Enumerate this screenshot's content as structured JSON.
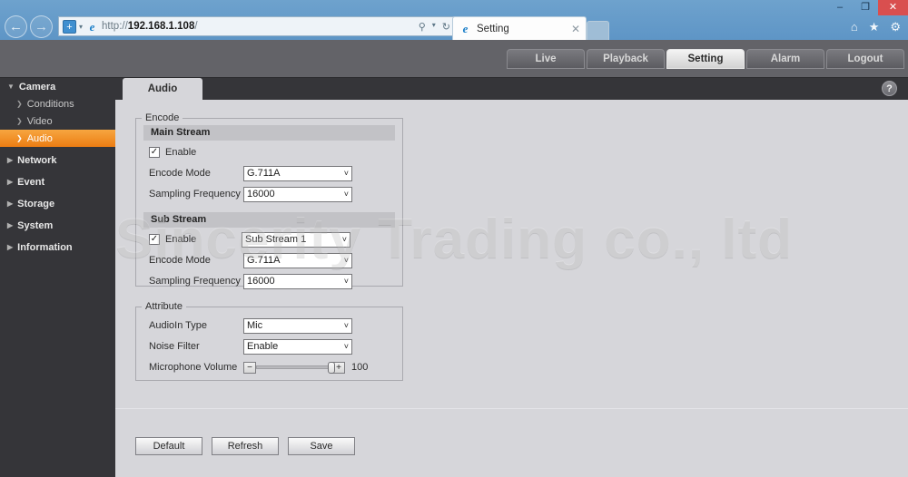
{
  "browser": {
    "window_controls": {
      "minimize": "–",
      "maximize": "❐",
      "close": "✕"
    },
    "back_icon": "←",
    "forward_icon": "→",
    "compat_icon": "+",
    "ie_logo": "e",
    "url_prefix": "http://",
    "url_host": "192.168.1.108",
    "url_suffix": "/",
    "search_icon": "⚲",
    "refresh_icon": "↻",
    "tab": {
      "title": "Setting",
      "close_icon": "✕"
    },
    "tools": {
      "home_icon": "⌂",
      "favorites_icon": "★",
      "settings_icon": "⚙"
    }
  },
  "app": {
    "brand": "",
    "tabs": [
      {
        "label": "Live",
        "active": false
      },
      {
        "label": "Playback",
        "active": false
      },
      {
        "label": "Setting",
        "active": true
      },
      {
        "label": "Alarm",
        "active": false
      },
      {
        "label": "Logout",
        "active": false
      }
    ]
  },
  "sidebar": {
    "items": [
      {
        "label": "Camera",
        "level": "group",
        "expanded": true,
        "icon": "▼"
      },
      {
        "label": "Conditions",
        "level": "child",
        "icon": "❯"
      },
      {
        "label": "Video",
        "level": "child",
        "icon": "❯"
      },
      {
        "label": "Audio",
        "level": "child",
        "icon": "❯",
        "active": true
      },
      {
        "label": "Network",
        "level": "group",
        "icon": "▶"
      },
      {
        "label": "Event",
        "level": "group",
        "icon": "▶"
      },
      {
        "label": "Storage",
        "level": "group",
        "icon": "▶"
      },
      {
        "label": "System",
        "level": "group",
        "icon": "▶"
      },
      {
        "label": "Information",
        "level": "group",
        "icon": "▶"
      }
    ]
  },
  "content": {
    "page_tab": "Audio",
    "help_icon": "?",
    "encode": {
      "legend": "Encode",
      "main_stream": {
        "header": "Main Stream",
        "enable_label": "Enable",
        "enable_checked": true,
        "check_glyph": "✓",
        "encode_mode_label": "Encode Mode",
        "encode_mode_value": "G.711A",
        "sampling_label": "Sampling Frequency",
        "sampling_value": "16000"
      },
      "sub_stream": {
        "header": "Sub Stream",
        "enable_label": "Enable",
        "enable_checked": true,
        "check_glyph": "✓",
        "stream_select_value": "Sub Stream 1",
        "encode_mode_label": "Encode Mode",
        "encode_mode_value": "G.711A",
        "sampling_label": "Sampling Frequency",
        "sampling_value": "16000"
      }
    },
    "attribute": {
      "legend": "Attribute",
      "audioin_label": "AudioIn Type",
      "audioin_value": "Mic",
      "noise_label": "Noise Filter",
      "noise_value": "Enable",
      "volume_label": "Microphone Volume",
      "volume_minus": "−",
      "volume_plus": "+",
      "volume_value": "100"
    },
    "buttons": [
      {
        "label": "Default"
      },
      {
        "label": "Refresh"
      },
      {
        "label": "Save"
      }
    ],
    "caret_down": "˅"
  },
  "watermark": {
    "text": "Sincerity Trading co., ltd"
  },
  "colors": {
    "accent": "#ec7d13",
    "header": "#636368",
    "sidebar": "#353539",
    "content": "#d6d6da"
  }
}
